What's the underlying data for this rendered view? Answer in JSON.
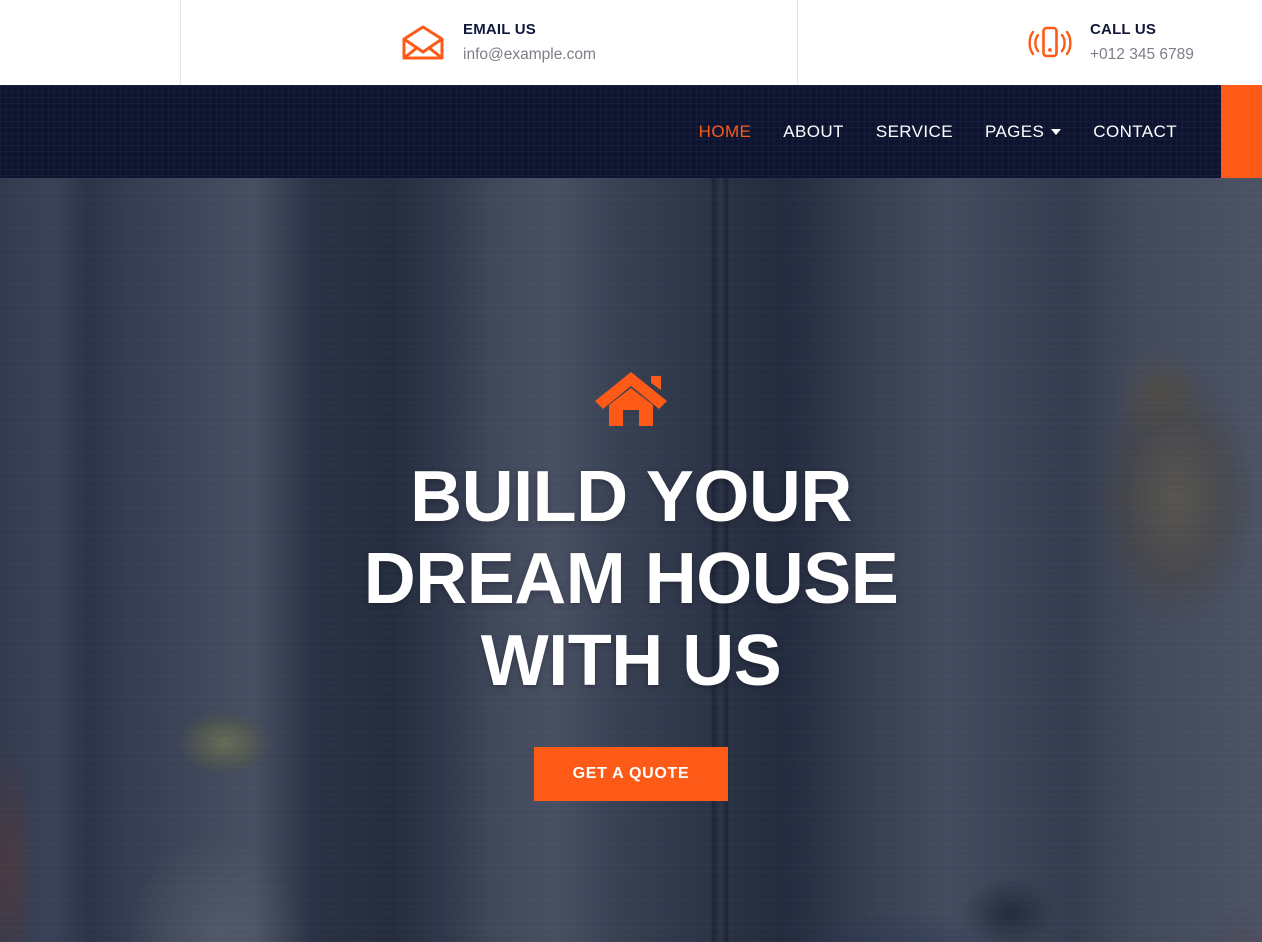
{
  "topbar": {
    "email": {
      "icon": "envelope-open-icon",
      "label": "EMAIL US",
      "value": "info@example.com"
    },
    "call": {
      "icon": "mobile-vibrate-icon",
      "label": "CALL US",
      "value": "+012 345 6789"
    }
  },
  "navbar": {
    "items": [
      {
        "label": "HOME",
        "active": true,
        "dropdown": false
      },
      {
        "label": "ABOUT",
        "active": false,
        "dropdown": false
      },
      {
        "label": "SERVICE",
        "active": false,
        "dropdown": false
      },
      {
        "label": "PAGES",
        "active": false,
        "dropdown": true
      },
      {
        "label": "CONTACT",
        "active": false,
        "dropdown": false
      }
    ]
  },
  "hero": {
    "icon": "home-icon",
    "title": "BUILD YOUR DREAM HOUSE WITH US",
    "button_label": "GET A QUOTE"
  },
  "colors": {
    "accent_orange": "#fc5a16",
    "nav_navy": "#0d1430",
    "heading_navy": "#10183a",
    "muted_gray": "#7b7f88",
    "white": "#ffffff"
  }
}
